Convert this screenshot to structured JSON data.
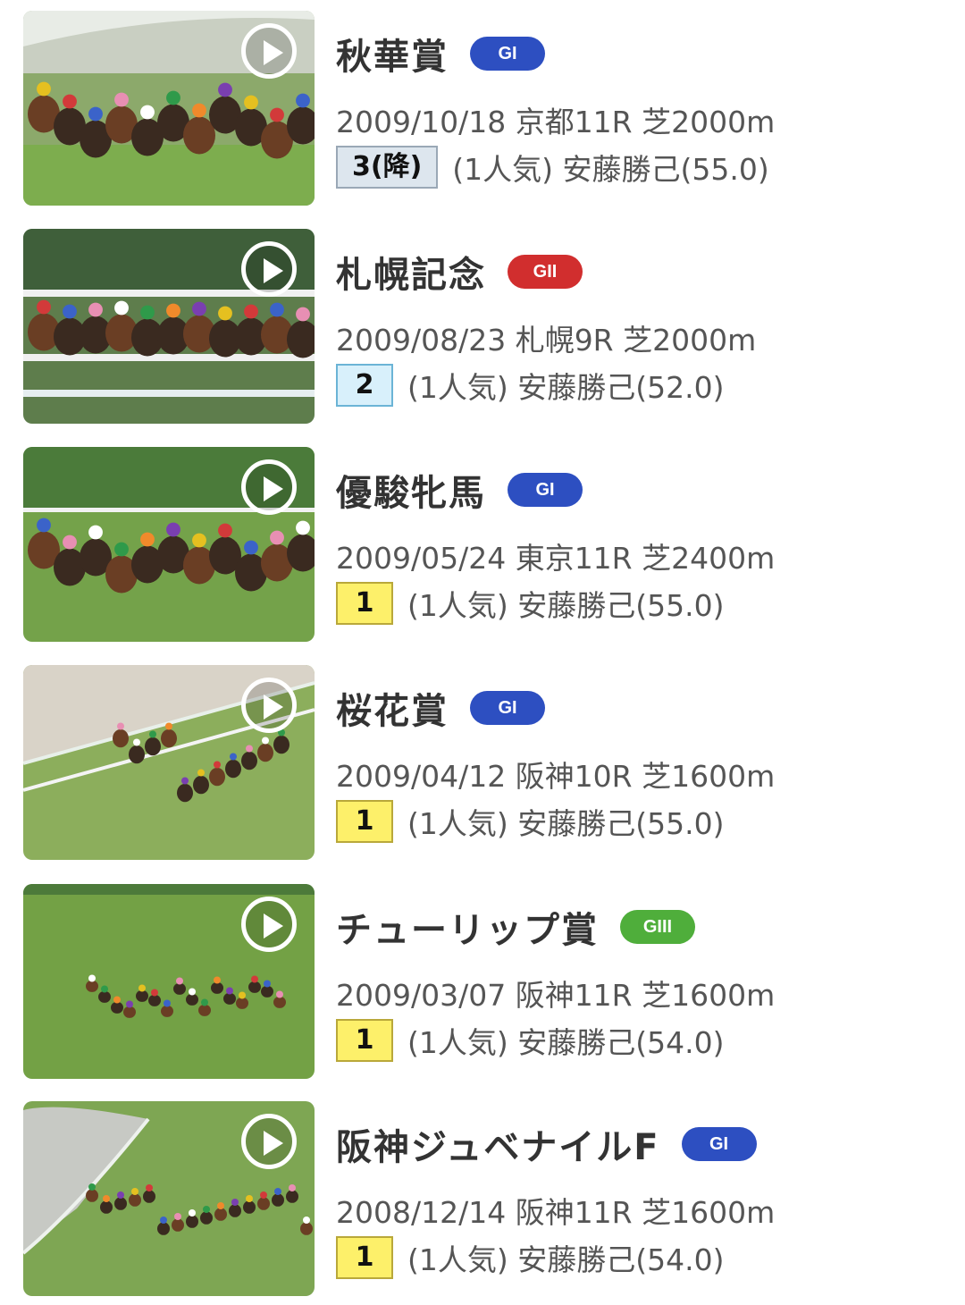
{
  "races": [
    {
      "name": "秋華賞",
      "grade": "GI",
      "grade_color": "#2d4fc1",
      "info": "2009/10/18 京都11R 芝2000m",
      "place": "3(降)",
      "place_bg": "#dde6ee",
      "place_border": "#9aa8b6",
      "result": "(1人気) 安藤勝己(55.0)",
      "thumb_scene": "track-crowd"
    },
    {
      "name": "札幌記念",
      "grade": "GII",
      "grade_color": "#d12e2e",
      "info": "2009/08/23 札幌9R 芝2000m",
      "place": "2",
      "place_bg": "#d8f0fb",
      "place_border": "#6bb4d6",
      "result": "(1人気) 安藤勝己(52.0)",
      "thumb_scene": "rail-closeup"
    },
    {
      "name": "優駿牝馬",
      "grade": "GI",
      "grade_color": "#2d4fc1",
      "info": "2009/05/24 東京11R 芝2400m",
      "place": "1",
      "place_bg": "#fdf06a",
      "place_border": "#b9a83a",
      "result": "(1人気) 安藤勝己(55.0)",
      "thumb_scene": "turn-field"
    },
    {
      "name": "桜花賞",
      "grade": "GI",
      "grade_color": "#2d4fc1",
      "info": "2009/04/12 阪神10R 芝1600m",
      "place": "1",
      "place_bg": "#fdf06a",
      "place_border": "#b9a83a",
      "result": "(1人気) 安藤勝己(55.0)",
      "thumb_scene": "aerial-rail"
    },
    {
      "name": "チューリップ賞",
      "grade": "GIII",
      "grade_color": "#4fae3b",
      "info": "2009/03/07 阪神11R 芝1600m",
      "place": "1",
      "place_bg": "#fdf06a",
      "place_border": "#b9a83a",
      "result": "(1人気) 安藤勝己(54.0)",
      "thumb_scene": "wide-field"
    },
    {
      "name": "阪神ジュベナイルF",
      "grade": "GI",
      "grade_color": "#2d4fc1",
      "info": "2008/12/14 阪神11R 芝1600m",
      "place": "1",
      "place_bg": "#fdf06a",
      "place_border": "#b9a83a",
      "result": "(1人気) 安藤勝己(54.0)",
      "thumb_scene": "curve-field"
    }
  ]
}
